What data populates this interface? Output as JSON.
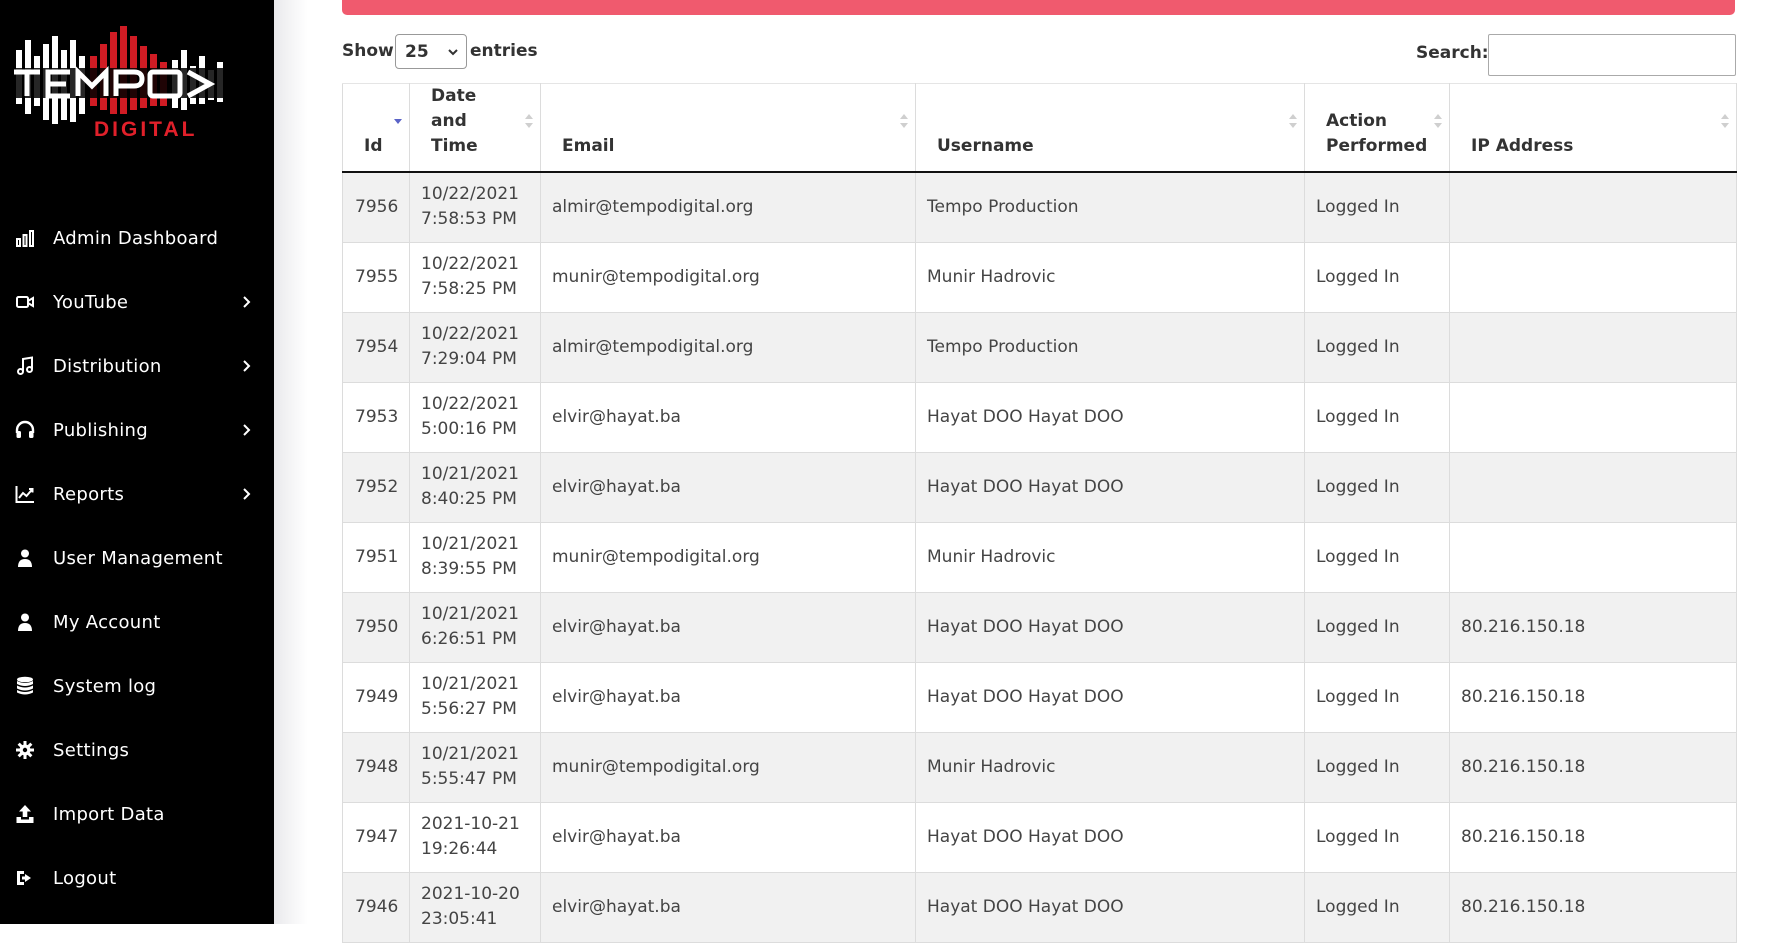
{
  "brand": {
    "logo_text": "TEMPO",
    "logo_subtext": "DIGITAL",
    "accent_color": "#e0202a"
  },
  "sidebar": {
    "items": [
      {
        "label": "Admin Dashboard",
        "icon": "bar-chart-icon",
        "has_submenu": false
      },
      {
        "label": "YouTube",
        "icon": "video-camera-icon",
        "has_submenu": true
      },
      {
        "label": "Distribution",
        "icon": "music-note-icon",
        "has_submenu": true
      },
      {
        "label": "Publishing",
        "icon": "headphones-icon",
        "has_submenu": true
      },
      {
        "label": "Reports",
        "icon": "line-chart-icon",
        "has_submenu": true
      },
      {
        "label": "User Management",
        "icon": "user-icon",
        "has_submenu": false
      },
      {
        "label": "My Account",
        "icon": "user-icon",
        "has_submenu": false
      },
      {
        "label": "System log",
        "icon": "database-icon",
        "has_submenu": false
      },
      {
        "label": "Settings",
        "icon": "gear-icon",
        "has_submenu": false
      },
      {
        "label": "Import Data",
        "icon": "upload-icon",
        "has_submenu": false
      },
      {
        "label": "Logout",
        "icon": "logout-icon",
        "has_submenu": false
      }
    ]
  },
  "controls": {
    "show_label": "Show",
    "entries_value": "25",
    "entries_label": "entries",
    "search_label": "Search:",
    "search_value": ""
  },
  "table": {
    "columns": [
      {
        "label": "Id",
        "sort": "asc-active"
      },
      {
        "label": "Date and Time",
        "sort": "none"
      },
      {
        "label": "Email",
        "sort": "none"
      },
      {
        "label": "Username",
        "sort": "none"
      },
      {
        "label": "Action Performed",
        "sort": "none"
      },
      {
        "label": "IP Address",
        "sort": "none"
      }
    ],
    "rows": [
      {
        "id": "7956",
        "date": "10/22/2021",
        "time": "7:58:53 PM",
        "email": "almir@tempodigital.org",
        "username": "Tempo Production",
        "action": "Logged In",
        "ip": ""
      },
      {
        "id": "7955",
        "date": "10/22/2021",
        "time": "7:58:25 PM",
        "email": "munir@tempodigital.org",
        "username": "Munir Hadrovic",
        "action": "Logged In",
        "ip": ""
      },
      {
        "id": "7954",
        "date": "10/22/2021",
        "time": "7:29:04 PM",
        "email": "almir@tempodigital.org",
        "username": "Tempo Production",
        "action": "Logged In",
        "ip": ""
      },
      {
        "id": "7953",
        "date": "10/22/2021",
        "time": "5:00:16 PM",
        "email": "elvir@hayat.ba",
        "username": "Hayat DOO Hayat DOO",
        "action": "Logged In",
        "ip": ""
      },
      {
        "id": "7952",
        "date": "10/21/2021",
        "time": "8:40:25 PM",
        "email": "elvir@hayat.ba",
        "username": "Hayat DOO Hayat DOO",
        "action": "Logged In",
        "ip": ""
      },
      {
        "id": "7951",
        "date": "10/21/2021",
        "time": "8:39:55 PM",
        "email": "munir@tempodigital.org",
        "username": "Munir Hadrovic",
        "action": "Logged In",
        "ip": ""
      },
      {
        "id": "7950",
        "date": "10/21/2021",
        "time": "6:26:51 PM",
        "email": "elvir@hayat.ba",
        "username": "Hayat DOO Hayat DOO",
        "action": "Logged In",
        "ip": "80.216.150.18"
      },
      {
        "id": "7949",
        "date": "10/21/2021",
        "time": "5:56:27 PM",
        "email": "elvir@hayat.ba",
        "username": "Hayat DOO Hayat DOO",
        "action": "Logged In",
        "ip": "80.216.150.18"
      },
      {
        "id": "7948",
        "date": "10/21/2021",
        "time": "5:55:47 PM",
        "email": "munir@tempodigital.org",
        "username": "Munir Hadrovic",
        "action": "Logged In",
        "ip": "80.216.150.18"
      },
      {
        "id": "7947",
        "date": "2021-10-21",
        "time": "19:26:44",
        "email": "elvir@hayat.ba",
        "username": "Hayat DOO Hayat DOO",
        "action": "Logged In",
        "ip": "80.216.150.18"
      },
      {
        "id": "7946",
        "date": "2021-10-20",
        "time": "23:05:41",
        "email": "elvir@hayat.ba",
        "username": "Hayat DOO Hayat DOO",
        "action": "Logged In",
        "ip": "80.216.150.18"
      }
    ]
  }
}
